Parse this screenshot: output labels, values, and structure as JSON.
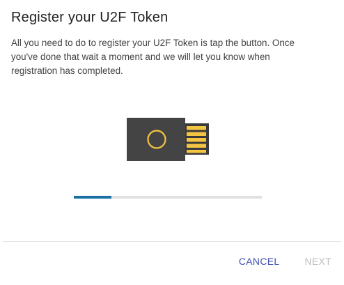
{
  "dialog": {
    "title": "Register your U2F Token",
    "body": "All you need to do to register your U2F Token is tap the button. Once you've done that wait a moment and we will let you know when registration has completed."
  },
  "illustration": {
    "icon": "usb-security-key-icon",
    "body_color": "#444444",
    "contact_color": "#f4c542"
  },
  "progress": {
    "fraction": 0.2,
    "fill_color": "#1a6fa3",
    "track_color": "#e0e0e0"
  },
  "actions": {
    "cancel_label": "CANCEL",
    "next_label": "NEXT",
    "next_disabled": true
  }
}
